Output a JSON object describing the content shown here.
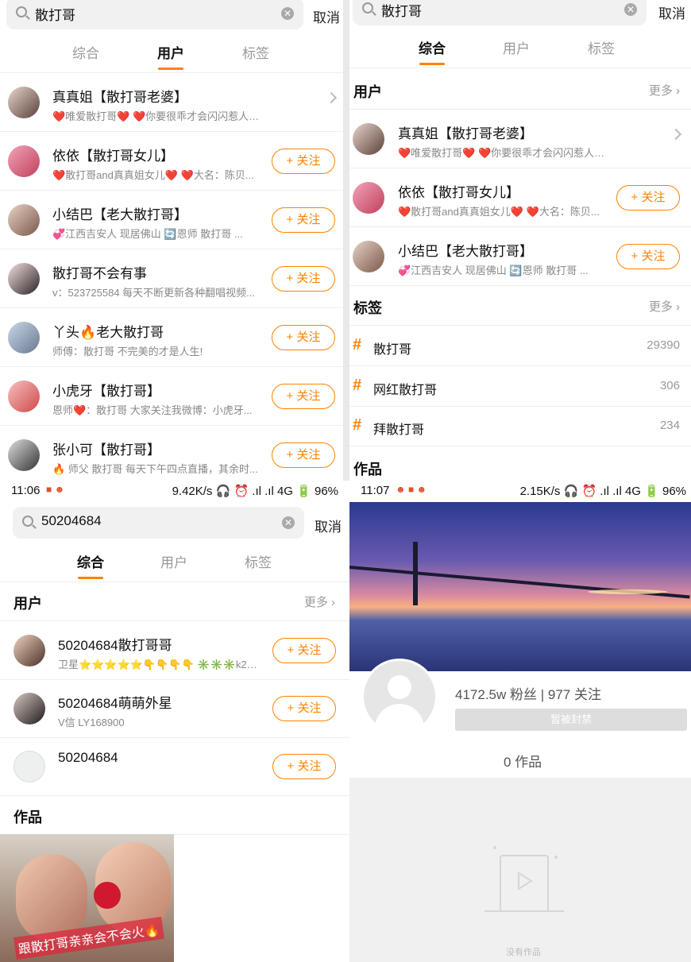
{
  "p1": {
    "search_query": "散打哥",
    "cancel": "取消",
    "tabs": [
      "综合",
      "用户",
      "标签"
    ],
    "users": [
      {
        "name": "真真姐【散打哥老婆】",
        "desc": "❤️唯爱散打哥❤️ ❤️你要很乖才会闪闪惹人爱 ❤️ 👗 \\/..."
      },
      {
        "name": "依依【散打哥女儿】",
        "desc": "❤️散打哥and真真姐女儿❤️ ❤️大名：陈贝...",
        "follow": "+ 关注"
      },
      {
        "name": "小结巴【老大散打哥】",
        "desc": "💞江西吉安人 现居佛山 🔄恩师 散打哥 ...",
        "follow": "+ 关注"
      },
      {
        "name": "散打哥不会有事",
        "desc": "v：523725584 每天不断更新各种翻唱视频...",
        "follow": "+ 关注"
      },
      {
        "name": "丫头🔥老大散打哥",
        "desc": "师傅：散打哥 不完美的才是人生!",
        "follow": "+ 关注"
      },
      {
        "name": "小虎牙【散打哥】",
        "desc": "恩师❤️：散打哥 大家关注我微博：小虎牙...",
        "follow": "+ 关注"
      },
      {
        "name": "张小可【散打哥】",
        "desc": "🔥 师父 散打哥 每天下午四点直播，其余时...",
        "follow": "+ 关注"
      }
    ]
  },
  "p2": {
    "search_query": "散打哥",
    "cancel": "取消",
    "tabs": [
      "综合",
      "用户",
      "标签"
    ],
    "users_section": "用户",
    "more": "更多 ›",
    "users": [
      {
        "name": "真真姐【散打哥老婆】",
        "desc": "❤️唯爱散打哥❤️ ❤️你要很乖才会闪闪惹人爱 ❤️ 👗 \\/..."
      },
      {
        "name": "依依【散打哥女儿】",
        "desc": "❤️散打哥and真真姐女儿❤️ ❤️大名：陈贝...",
        "follow": "+ 关注"
      },
      {
        "name": "小结巴【老大散打哥】",
        "desc": "💞江西吉安人 现居佛山 🔄恩师 散打哥 ...",
        "follow": "+ 关注"
      }
    ],
    "tags_section": "标签",
    "tags": [
      {
        "name": "散打哥",
        "count": "29390"
      },
      {
        "name": "网红散打哥",
        "count": "306"
      },
      {
        "name": "拜散打哥",
        "count": "234"
      }
    ],
    "works_section": "作品"
  },
  "p3": {
    "status_time": "11:06",
    "status_right": "9.42K/s 🎧 ⏰ .ıl .ıl 4G 🔋 96%",
    "search_query": "50204684",
    "cancel": "取消",
    "tabs": [
      "综合",
      "用户",
      "标签"
    ],
    "users_section": "用户",
    "more": "更多 ›",
    "users": [
      {
        "name": "50204684散打哥哥",
        "desc": "卫星⭐⭐⭐⭐⭐👇👇👇👇 ✳️✳️✳️k20700...",
        "follow": "+ 关注"
      },
      {
        "name": "50204684萌萌外星",
        "desc": "V信 LY168900",
        "follow": "+ 关注"
      },
      {
        "name": "50204684",
        "desc": "",
        "follow": "+ 关注"
      }
    ],
    "works_section": "作品",
    "thumb_caption": "跟散打哥亲亲会不会火🔥"
  },
  "p4": {
    "status_time": "11:07",
    "status_right": "2.15K/s 🎧 ⏰ .ıl .ıl 4G 🔋 96%",
    "stats": "4172.5w 粉丝 | 977 关注",
    "banned": "暂被封禁",
    "works_count": "0 作品",
    "empty_text": "没有作品"
  },
  "colors": {
    "accent": "#ff8200"
  }
}
